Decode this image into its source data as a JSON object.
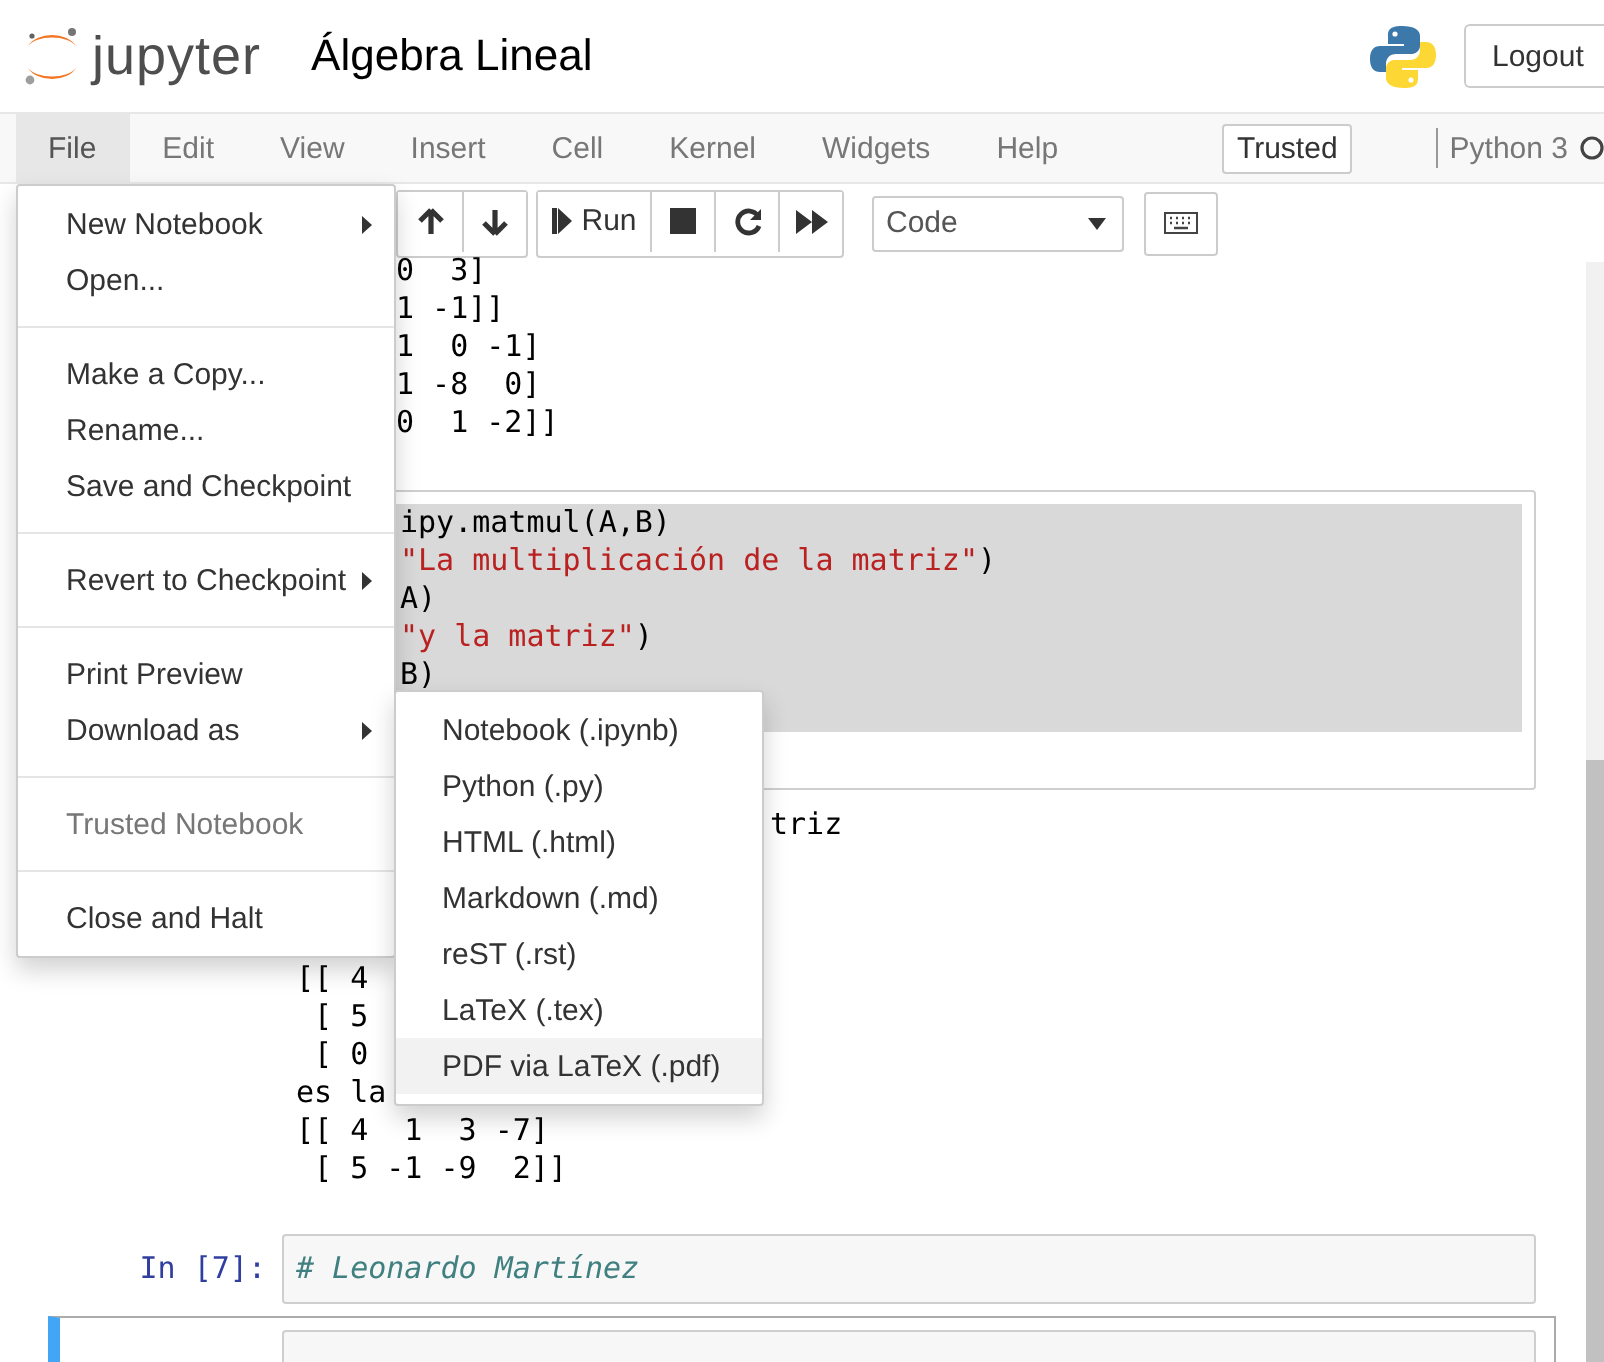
{
  "header": {
    "logo_text": "jupyter",
    "title": "Álgebra Lineal",
    "logout": "Logout"
  },
  "menubar": {
    "items": [
      {
        "label": "File",
        "selected": true
      },
      {
        "label": "Edit",
        "selected": false
      },
      {
        "label": "View",
        "selected": false
      },
      {
        "label": "Insert",
        "selected": false
      },
      {
        "label": "Cell",
        "selected": false
      },
      {
        "label": "Kernel",
        "selected": false
      },
      {
        "label": "Widgets",
        "selected": false
      },
      {
        "label": "Help",
        "selected": false
      }
    ],
    "trusted": "Trusted",
    "kernel": "Python 3"
  },
  "toolbar": {
    "run": "Run",
    "cell_type": "Code"
  },
  "notebook": {
    "output_1": [
      "0  3]",
      "1 -1]]",
      "1  0 -1]",
      "1 -8  0]",
      "0  1 -2]]"
    ],
    "code_cell": {
      "selected": false,
      "lines": [
        [
          {
            "kind": "plain",
            "text": "ipy.matmul(A,B)"
          }
        ],
        [
          {
            "kind": "string",
            "text": "\"La multiplicación de la matriz\""
          },
          {
            "kind": "plain",
            "text": ")"
          }
        ],
        [
          {
            "kind": "plain",
            "text": "A)"
          }
        ],
        [
          {
            "kind": "string",
            "text": "\"y la matriz\""
          },
          {
            "kind": "plain",
            "text": ")"
          }
        ],
        [
          {
            "kind": "plain",
            "text": "B)"
          }
        ]
      ]
    },
    "output_2": {
      "fragment": "triz",
      "lines": [
        "[[ 4",
        " [ 5",
        " [ 0",
        "es la",
        "[[ 4  1  3 -7]",
        " [ 5 -1 -9  2]]"
      ]
    },
    "cells": [
      {
        "prompt": "In [7]:",
        "selected": false,
        "lines": [
          [
            {
              "kind": "comment",
              "text": "# Leonardo Martínez"
            }
          ]
        ]
      },
      {
        "selected": true
      }
    ]
  },
  "file_menu": {
    "groups": [
      {
        "items": [
          {
            "label": "New Notebook",
            "submenu": true,
            "disabled": false
          },
          {
            "label": "Open...",
            "submenu": false,
            "disabled": false
          }
        ]
      },
      {
        "items": [
          {
            "label": "Make a Copy...",
            "submenu": false,
            "disabled": false
          },
          {
            "label": "Rename...",
            "submenu": false,
            "disabled": false
          },
          {
            "label": "Save and Checkpoint",
            "submenu": false,
            "disabled": false
          }
        ]
      },
      {
        "items": [
          {
            "label": "Revert to Checkpoint",
            "submenu": true,
            "disabled": false
          }
        ]
      },
      {
        "items": [
          {
            "label": "Print Preview",
            "submenu": false,
            "disabled": false
          },
          {
            "label": "Download as",
            "submenu": true,
            "disabled": false
          }
        ]
      },
      {
        "items": [
          {
            "label": "Trusted Notebook",
            "submenu": false,
            "disabled": true
          }
        ]
      },
      {
        "items": [
          {
            "label": "Close and Halt",
            "submenu": false,
            "disabled": false
          }
        ]
      }
    ]
  },
  "download_submenu": {
    "items": [
      {
        "label": "Notebook (.ipynb)",
        "selected": false
      },
      {
        "label": "Python (.py)",
        "selected": false
      },
      {
        "label": "HTML (.html)",
        "selected": false
      },
      {
        "label": "Markdown (.md)",
        "selected": false
      },
      {
        "label": "reST (.rst)",
        "selected": false
      },
      {
        "label": "LaTeX (.tex)",
        "selected": false
      },
      {
        "label": "PDF via LaTeX (.pdf)",
        "selected": true
      }
    ]
  }
}
